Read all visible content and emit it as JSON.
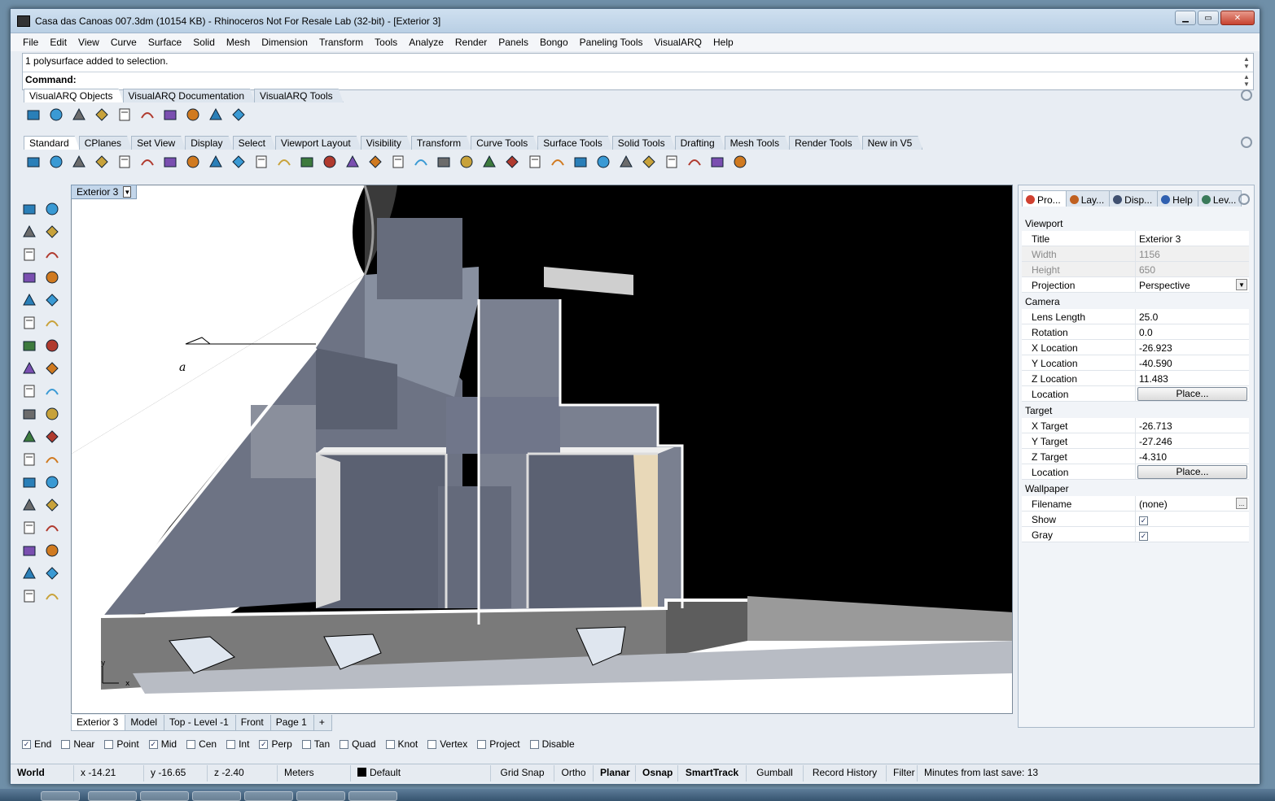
{
  "window": {
    "title": "Casa das Canoas 007.3dm (10154 KB) - Rhinoceros Not For Resale Lab (32-bit) - [Exterior 3]"
  },
  "menu": [
    "File",
    "Edit",
    "View",
    "Curve",
    "Surface",
    "Solid",
    "Mesh",
    "Dimension",
    "Transform",
    "Tools",
    "Analyze",
    "Render",
    "Panels",
    "Bongo",
    "Paneling Tools",
    "VisualARQ",
    "Help"
  ],
  "command": {
    "history": "1 polysurface added to selection.",
    "prompt": "Command:"
  },
  "visualarq_tabs": [
    "VisualARQ Objects",
    "VisualARQ Documentation",
    "VisualARQ Tools"
  ],
  "visualarq_icons": [
    "wall-icon",
    "curtain-wall-icon",
    "slab-icon",
    "column-icon",
    "door-icon",
    "window-icon",
    "stair-icon",
    "railing-icon",
    "roof-icon",
    "level-icon"
  ],
  "toolbar_tabs": [
    "Standard",
    "CPlanes",
    "Set View",
    "Display",
    "Select",
    "Viewport Layout",
    "Visibility",
    "Transform",
    "Curve Tools",
    "Surface Tools",
    "Solid Tools",
    "Drafting",
    "Mesh Tools",
    "Render Tools",
    "New in V5"
  ],
  "standard_icons": [
    "new-icon",
    "open-icon",
    "save-icon",
    "print-icon",
    "import-icon",
    "cut-icon",
    "copy-icon",
    "paste-icon",
    "undo-icon",
    "pan-icon",
    "rotate-view-icon",
    "zoom-icon",
    "zoom-window-icon",
    "zoom-extents-icon",
    "zoom-selected-icon",
    "rotate-icon",
    "four-viewports-icon",
    "car-icon",
    "shaded-icon",
    "rendered-icon",
    "cplane-icon",
    "light-icon",
    "lock-icon",
    "layer-icon",
    "color-wheel-icon",
    "sphere-icon",
    "sphere-render-icon",
    "material-icon",
    "spotlight-icon",
    "options-icon",
    "grid-icon",
    "help-icon"
  ],
  "left_tools": [
    [
      "select-icon",
      "point-icon"
    ],
    [
      "polyline-icon",
      "curve-icon"
    ],
    [
      "circle-icon",
      "ellipse-icon"
    ],
    [
      "arc-icon",
      "rectangle-icon"
    ],
    [
      "polygon-icon",
      "fillet-icon"
    ],
    [
      "surface-icon",
      "revolve-icon"
    ],
    [
      "box-icon",
      "boolean-icon"
    ],
    [
      "cylinder-icon",
      "extrude-icon"
    ],
    [
      "explode-icon",
      "star-icon"
    ],
    [
      "split-icon",
      "trim-icon"
    ],
    [
      "group-icon",
      "cluster-icon"
    ],
    [
      "offset-icon",
      "curve-from-object-icon"
    ],
    [
      "text-icon",
      "dimension-icon"
    ],
    [
      "array-icon",
      "transform-icon"
    ],
    [
      "mesh-icon",
      "section-icon"
    ],
    [
      "grid-array-icon",
      "level-icon"
    ],
    [
      "analyze-icon",
      "check-icon"
    ],
    [
      "render-icon",
      "paint-icon"
    ]
  ],
  "viewport": {
    "label": "Exterior 3",
    "annotation_letter": "a",
    "axis_y": "y",
    "axis_x": "x"
  },
  "viewport_tabs": [
    "Exterior 3",
    "Model",
    "Top - Level -1",
    "Front",
    "Page 1",
    "+"
  ],
  "panel": {
    "tabs": [
      "Pro...",
      "Lay...",
      "Disp...",
      "Help",
      "Lev..."
    ],
    "sections": {
      "viewport": "Viewport",
      "camera": "Camera",
      "target": "Target",
      "wallpaper": "Wallpaper"
    },
    "viewport_rows": [
      {
        "k": "Title",
        "v": "Exterior 3"
      },
      {
        "k": "Width",
        "v": "1156"
      },
      {
        "k": "Height",
        "v": "650"
      },
      {
        "k": "Projection",
        "v": "Perspective"
      }
    ],
    "camera_rows": [
      {
        "k": "Lens Length",
        "v": "25.0"
      },
      {
        "k": "Rotation",
        "v": "0.0"
      },
      {
        "k": "X Location",
        "v": "-26.923"
      },
      {
        "k": "Y Location",
        "v": "-40.590"
      },
      {
        "k": "Z Location",
        "v": "11.483"
      },
      {
        "k": "Location",
        "v": "Place..."
      }
    ],
    "target_rows": [
      {
        "k": "X Target",
        "v": "-26.713"
      },
      {
        "k": "Y Target",
        "v": "-27.246"
      },
      {
        "k": "Z Target",
        "v": "-4.310"
      },
      {
        "k": "Location",
        "v": "Place..."
      }
    ],
    "wallpaper_rows": [
      {
        "k": "Filename",
        "v": "(none)",
        "btn": "..."
      },
      {
        "k": "Show",
        "v": "✓"
      },
      {
        "k": "Gray",
        "v": "✓"
      }
    ]
  },
  "osnap": [
    {
      "label": "End",
      "checked": true
    },
    {
      "label": "Near",
      "checked": false
    },
    {
      "label": "Point",
      "checked": false
    },
    {
      "label": "Mid",
      "checked": true
    },
    {
      "label": "Cen",
      "checked": false
    },
    {
      "label": "Int",
      "checked": false
    },
    {
      "label": "Perp",
      "checked": true
    },
    {
      "label": "Tan",
      "checked": false
    },
    {
      "label": "Quad",
      "checked": false
    },
    {
      "label": "Knot",
      "checked": false
    },
    {
      "label": "Vertex",
      "checked": false
    },
    {
      "label": "Project",
      "checked": false
    },
    {
      "label": "Disable",
      "checked": false
    }
  ],
  "status": {
    "cplane": "World",
    "x": "x -14.21",
    "y": "y -16.65",
    "z": "z -2.40",
    "units": "Meters",
    "layer": "Default",
    "toggles": [
      {
        "label": "Grid Snap",
        "bold": false
      },
      {
        "label": "Ortho",
        "bold": false
      },
      {
        "label": "Planar",
        "bold": true
      },
      {
        "label": "Osnap",
        "bold": true
      },
      {
        "label": "SmartTrack",
        "bold": true
      },
      {
        "label": "Gumball",
        "bold": false
      },
      {
        "label": "Record History",
        "bold": false
      },
      {
        "label": "Filter",
        "bold": false
      }
    ],
    "save": "Minutes from last save: 13"
  }
}
